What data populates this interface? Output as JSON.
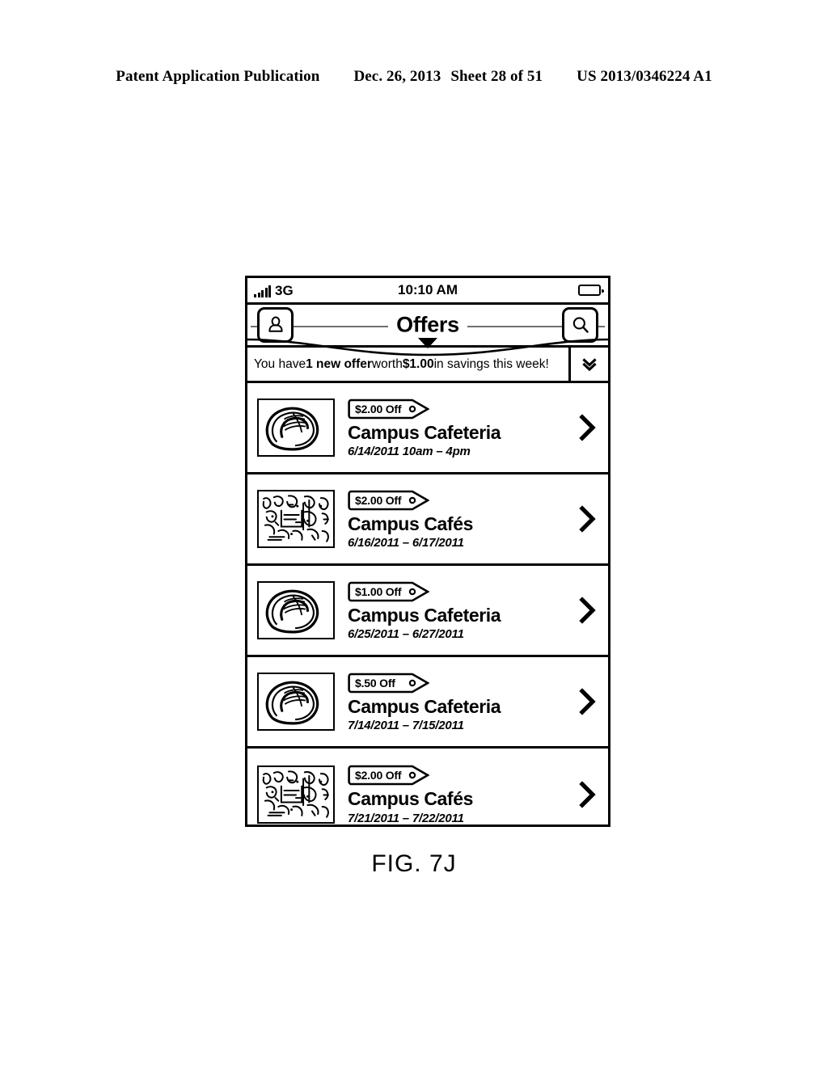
{
  "patent_header": {
    "publication": "Patent Application Publication",
    "date": "Dec. 26, 2013",
    "sheet": "Sheet 28 of 51",
    "number": "US 2013/0346224 A1"
  },
  "figure_caption": "FIG. 7J",
  "phone": {
    "status_bar": {
      "signal_icon": "signal-bars-icon",
      "carrier": "3G",
      "time": "10:10 AM",
      "battery_icon": "battery-icon"
    },
    "nav_bar": {
      "profile_icon": "person-icon",
      "title": "Offers",
      "search_icon": "magnifier-icon"
    },
    "banner": {
      "text_prefix": "You have ",
      "highlight_one": "1 new offer",
      "text_middle": " worth ",
      "highlight_two": "$1.00",
      "text_suffix": " in savings this week!",
      "expand_icon": "double-chevron-down-icon"
    },
    "offers": [
      {
        "thumbnail": "latte-art-icon",
        "discount": "$2.00 Off",
        "merchant": "Campus Cafeteria",
        "dates": "6/14/2011 10am – 4pm",
        "chevron_icon": "chevron-right-icon"
      },
      {
        "thumbnail": "cafe-sketch-icon",
        "discount": "$2.00 Off",
        "merchant": "Campus Cafés",
        "dates": "6/16/2011 – 6/17/2011",
        "chevron_icon": "chevron-right-icon"
      },
      {
        "thumbnail": "latte-art-icon",
        "discount": "$1.00 Off",
        "merchant": "Campus Cafeteria",
        "dates": "6/25/2011 – 6/27/2011",
        "chevron_icon": "chevron-right-icon"
      },
      {
        "thumbnail": "latte-art-icon",
        "discount": "$.50 Off",
        "merchant": "Campus Cafeteria",
        "dates": "7/14/2011 – 7/15/2011",
        "chevron_icon": "chevron-right-icon"
      },
      {
        "thumbnail": "cafe-sketch-icon",
        "discount": "$2.00 Off",
        "merchant": "Campus Cafés",
        "dates": "7/21/2011 – 7/22/2011",
        "chevron_icon": "chevron-right-icon"
      }
    ]
  }
}
